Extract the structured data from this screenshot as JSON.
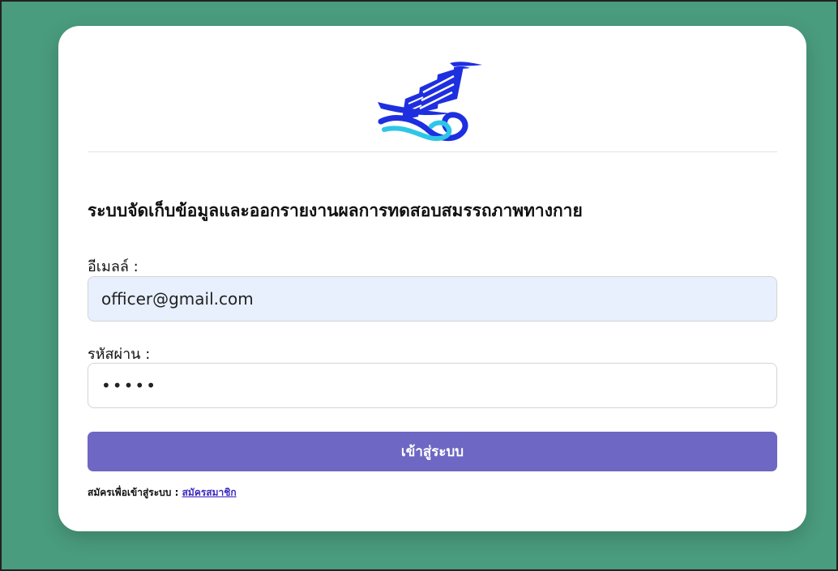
{
  "header": {
    "logo_name": "ship-logo-icon"
  },
  "form": {
    "title": "ระบบจัดเก็บข้อมูลและออกรายงานผลการทดสอบสมรรถภาพทางกาย",
    "email_label": "อีเมลล์ :",
    "email_value": "officer@gmail.com",
    "password_label": "รหัสผ่าน :",
    "password_value": "•••••",
    "login_label": "เข้าสู่ระบบ",
    "signup_prompt": "สมัครเพื่อเข้าสู่ระบบ : ",
    "signup_link": "สมัครสมาชิก"
  },
  "colors": {
    "background": "#4a9c7e",
    "button": "#6e67c3",
    "email_field_bg": "#e8f0fe",
    "logo_blue": "#1e2fe0",
    "logo_cyan": "#2ec6e6"
  }
}
